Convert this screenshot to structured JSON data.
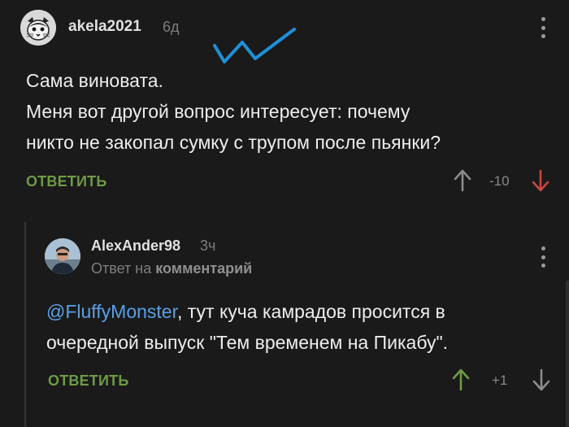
{
  "comment": {
    "username": "akela2021",
    "time": "6д",
    "lines": [
      "Сама виновата.",
      "Меня вот другой вопрос интересует: почему",
      "никто не закопал сумку с трупом после пьянки?"
    ],
    "reply_label": "ОТВЕТИТЬ",
    "score": "-10",
    "voted": "down"
  },
  "reply": {
    "username": "AlexAnder98",
    "time": "3ч",
    "reply_to_prefix": "Ответ на",
    "reply_to_link": "комментарий",
    "mention": "@FluffyMonster",
    "text_after_mention": ", тут куча камрадов просится в",
    "line2": "очередной выпуск \"Тем временем на Пикабу\".",
    "reply_label": "ОТВЕТИТЬ",
    "score": "+1",
    "voted": "up"
  },
  "colors": {
    "background": "#1a1a1a",
    "accent_green": "#6f9a45",
    "downvote_red": "#c9473f",
    "mention_blue": "#5aa0e6",
    "scribble_blue": "#1e90d8"
  }
}
